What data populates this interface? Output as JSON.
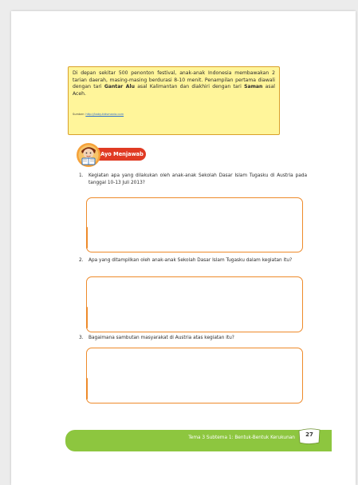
{
  "info": {
    "line_a": "Di depan sekitar 500 penonton festival, anak-anak Indonesia membawakan 2 tarian daerah, masing-masing berdurasi 8-10 menit. Penampilan pertama diawali dengan tari ",
    "bold_1": "Gantar Alu",
    "line_b": " asal Kalimantan dan diakhiri dengan tari ",
    "bold_2": "Saman",
    "line_c": " asal Aceh.",
    "source_label": "Sumber: ",
    "source_link": "http://baby.kidsmania.com"
  },
  "ayo_menjawab": "Ayo Menjawab",
  "questions": [
    {
      "number": "1.",
      "text": "Kegiatan apa yang dilakukan oleh anak-anak Sekolah Dasar Islam Tugasku di Austria pada tanggal 10-13 Juli 2013?"
    },
    {
      "number": "2.",
      "text": "Apa yang ditampilkan oleh anak-anak Sekolah Dasar Islam Tugasku dalam kegiatan itu?"
    },
    {
      "number": "3.",
      "text": "Bagaimana sambutan masyarakat di Austria atas kegiatan itu?"
    }
  ],
  "footer": {
    "text": "Tema 3 Subtema 1: Bentuk-Bentuk Kerukunan",
    "page_number": "27"
  },
  "colors": {
    "info_bg": "#fff59a",
    "accent_red": "#e03a23",
    "answer_border": "#ee8a2a",
    "footer_green": "#8dc63f"
  }
}
